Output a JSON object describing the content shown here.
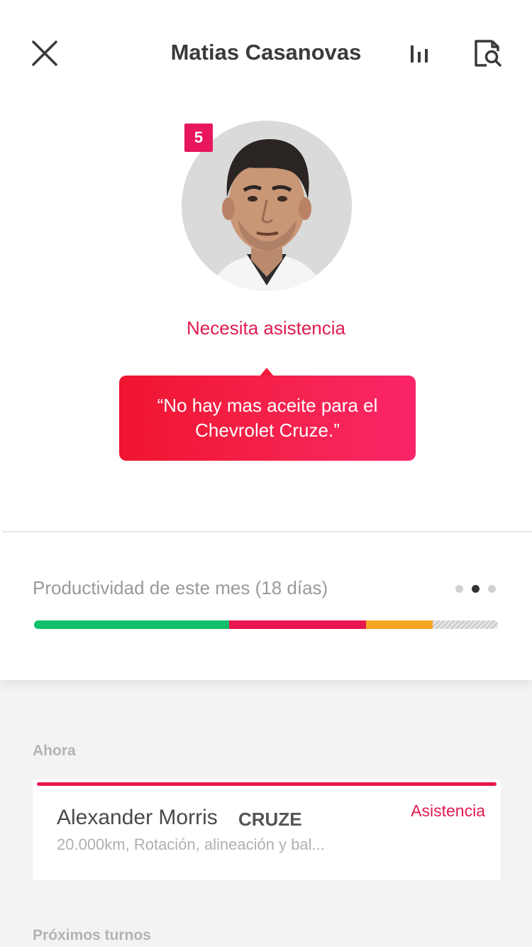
{
  "header": {
    "title": "Matias Casanovas",
    "icons": [
      "close-icon",
      "bar-chart-icon",
      "document-search-icon"
    ]
  },
  "profile": {
    "badge_count": "5",
    "status": "Necesita asistencia",
    "quote": "“No hay mas aceite para el Chevrolet Cruze.”"
  },
  "productivity": {
    "label": "Productividad de este mes (18 días)",
    "pager": {
      "count": 3,
      "active_index": 1
    },
    "segments": [
      {
        "name": "green",
        "fraction": 0.42,
        "color": "#10c06a"
      },
      {
        "name": "red",
        "fraction": 0.295,
        "color": "#e8174f"
      },
      {
        "name": "orange",
        "fraction": 0.145,
        "color": "#f5a623"
      },
      {
        "name": "remaining",
        "fraction": 0.14,
        "color": "hatched-gray"
      }
    ]
  },
  "now": {
    "section_title": "Ahora",
    "card": {
      "name": "Alexander Morris",
      "car": "CRUZE",
      "status": "Asistencia",
      "description": "20.000km, Rotación, alineación y bal...",
      "accent_color": "#e8174f"
    }
  },
  "upcoming": {
    "section_title": "Próximos turnos"
  },
  "colors": {
    "accent": "#e01b4f",
    "quote_gradient_start": "#f01530",
    "quote_gradient_end": "#fa2468"
  }
}
